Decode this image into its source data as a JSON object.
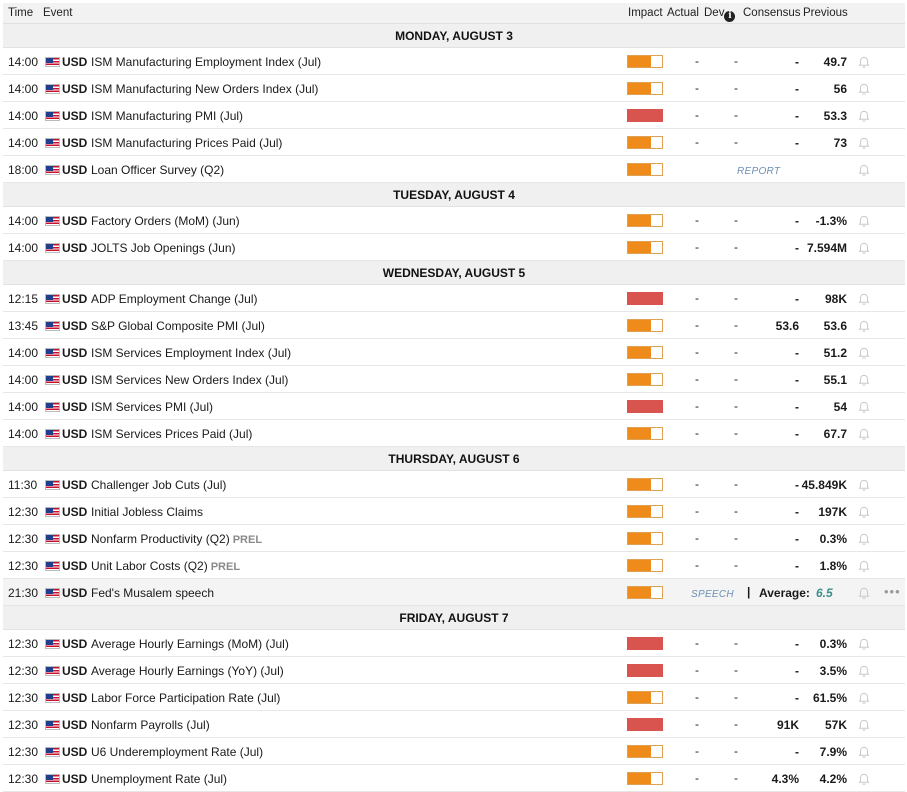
{
  "header": {
    "time": "Time",
    "event": "Event",
    "impact": "Impact",
    "actual": "Actual",
    "dev": "Dev",
    "consensus": "Consensus",
    "previous": "Previous"
  },
  "days": [
    {
      "label": "MONDAY, AUGUST 3",
      "events": [
        {
          "time": "14:00",
          "currency": "USD",
          "name": "ISM Manufacturing Employment Index (Jul)",
          "impact": "medium",
          "actual": "-",
          "dev": "-",
          "consensus": "-",
          "previous": "49.7"
        },
        {
          "time": "14:00",
          "currency": "USD",
          "name": "ISM Manufacturing New Orders Index (Jul)",
          "impact": "medium",
          "actual": "-",
          "dev": "-",
          "consensus": "-",
          "previous": "56"
        },
        {
          "time": "14:00",
          "currency": "USD",
          "name": "ISM Manufacturing PMI (Jul)",
          "impact": "high",
          "actual": "-",
          "dev": "-",
          "consensus": "-",
          "previous": "53.3"
        },
        {
          "time": "14:00",
          "currency": "USD",
          "name": "ISM Manufacturing Prices Paid (Jul)",
          "impact": "medium",
          "actual": "-",
          "dev": "-",
          "consensus": "-",
          "previous": "73"
        },
        {
          "time": "18:00",
          "currency": "USD",
          "name": "Loan Officer Survey (Q2)",
          "impact": "medium",
          "badge": "REPORT"
        }
      ]
    },
    {
      "label": "TUESDAY, AUGUST 4",
      "events": [
        {
          "time": "14:00",
          "currency": "USD",
          "name": "Factory Orders (MoM) (Jun)",
          "impact": "medium",
          "actual": "-",
          "dev": "-",
          "consensus": "-",
          "previous": "-1.3%"
        },
        {
          "time": "14:00",
          "currency": "USD",
          "name": "JOLTS Job Openings (Jun)",
          "impact": "medium",
          "actual": "-",
          "dev": "-",
          "consensus": "-",
          "previous": "7.594M"
        }
      ]
    },
    {
      "label": "WEDNESDAY, AUGUST 5",
      "events": [
        {
          "time": "12:15",
          "currency": "USD",
          "name": "ADP Employment Change (Jul)",
          "impact": "high",
          "actual": "-",
          "dev": "-",
          "consensus": "-",
          "previous": "98K"
        },
        {
          "time": "13:45",
          "currency": "USD",
          "name": "S&P Global Composite PMI (Jul)",
          "impact": "medium",
          "actual": "-",
          "dev": "-",
          "consensus": "53.6",
          "previous": "53.6"
        },
        {
          "time": "14:00",
          "currency": "USD",
          "name": "ISM Services Employment Index (Jul)",
          "impact": "medium",
          "actual": "-",
          "dev": "-",
          "consensus": "-",
          "previous": "51.2"
        },
        {
          "time": "14:00",
          "currency": "USD",
          "name": "ISM Services New Orders Index (Jul)",
          "impact": "medium",
          "actual": "-",
          "dev": "-",
          "consensus": "-",
          "previous": "55.1"
        },
        {
          "time": "14:00",
          "currency": "USD",
          "name": "ISM Services PMI (Jul)",
          "impact": "high",
          "actual": "-",
          "dev": "-",
          "consensus": "-",
          "previous": "54"
        },
        {
          "time": "14:00",
          "currency": "USD",
          "name": "ISM Services Prices Paid (Jul)",
          "impact": "medium",
          "actual": "-",
          "dev": "-",
          "consensus": "-",
          "previous": "67.7"
        }
      ]
    },
    {
      "label": "THURSDAY, AUGUST 6",
      "events": [
        {
          "time": "11:30",
          "currency": "USD",
          "name": "Challenger Job Cuts (Jul)",
          "impact": "medium",
          "actual": "-",
          "dev": "-",
          "consensus": "-",
          "previous": "45.849K"
        },
        {
          "time": "12:30",
          "currency": "USD",
          "name": "Initial Jobless Claims",
          "impact": "medium",
          "actual": "-",
          "dev": "-",
          "consensus": "-",
          "previous": "197K"
        },
        {
          "time": "12:30",
          "currency": "USD",
          "name": "Nonfarm Productivity (Q2)",
          "prel": "PREL",
          "impact": "medium",
          "actual": "-",
          "dev": "-",
          "consensus": "-",
          "previous": "0.3%"
        },
        {
          "time": "12:30",
          "currency": "USD",
          "name": "Unit Labor Costs (Q2)",
          "prel": "PREL",
          "impact": "medium",
          "actual": "-",
          "dev": "-",
          "consensus": "-",
          "previous": "1.8%"
        },
        {
          "time": "21:30",
          "currency": "USD",
          "name": "Fed's Musalem speech",
          "impact": "medium",
          "badge": "SPEECH",
          "average_label": "Average:",
          "average": "6.5",
          "highlight": true
        }
      ]
    },
    {
      "label": "FRIDAY, AUGUST 7",
      "events": [
        {
          "time": "12:30",
          "currency": "USD",
          "name": "Average Hourly Earnings (MoM) (Jul)",
          "impact": "high",
          "actual": "-",
          "dev": "-",
          "consensus": "-",
          "previous": "0.3%"
        },
        {
          "time": "12:30",
          "currency": "USD",
          "name": "Average Hourly Earnings (YoY) (Jul)",
          "impact": "high",
          "actual": "-",
          "dev": "-",
          "consensus": "-",
          "previous": "3.5%"
        },
        {
          "time": "12:30",
          "currency": "USD",
          "name": "Labor Force Participation Rate (Jul)",
          "impact": "medium",
          "actual": "-",
          "dev": "-",
          "consensus": "-",
          "previous": "61.5%"
        },
        {
          "time": "12:30",
          "currency": "USD",
          "name": "Nonfarm Payrolls (Jul)",
          "impact": "high",
          "actual": "-",
          "dev": "-",
          "consensus": "91K",
          "previous": "57K"
        },
        {
          "time": "12:30",
          "currency": "USD",
          "name": "U6 Underemployment Rate (Jul)",
          "impact": "medium",
          "actual": "-",
          "dev": "-",
          "consensus": "-",
          "previous": "7.9%"
        },
        {
          "time": "12:30",
          "currency": "USD",
          "name": "Unemployment Rate (Jul)",
          "impact": "medium",
          "actual": "-",
          "dev": "-",
          "consensus": "4.3%",
          "previous": "4.2%"
        }
      ]
    }
  ],
  "impact_levels": {
    "medium": 0.67,
    "high": 1.0
  },
  "colors": {
    "medium": "#ef8b1b",
    "high": "#d9534f",
    "average": "#3b8f8a",
    "badge": "#6d8fb1"
  },
  "icons": {
    "bell": "bell-icon",
    "info": "info-icon",
    "more": "more-icon",
    "flag": "us-flag-icon"
  }
}
